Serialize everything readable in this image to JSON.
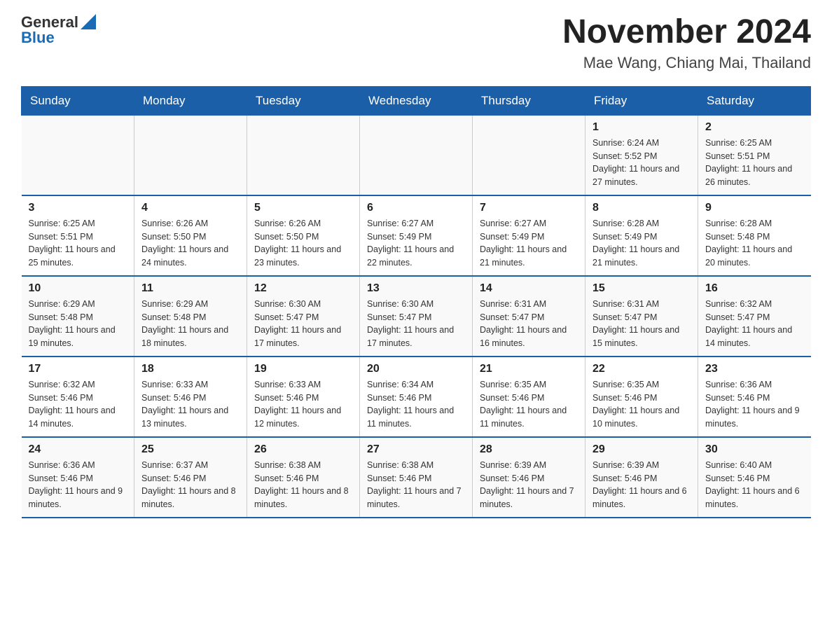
{
  "header": {
    "logo": {
      "general": "General",
      "blue": "Blue"
    },
    "title": "November 2024",
    "location": "Mae Wang, Chiang Mai, Thailand"
  },
  "weekdays": [
    "Sunday",
    "Monday",
    "Tuesday",
    "Wednesday",
    "Thursday",
    "Friday",
    "Saturday"
  ],
  "weeks": [
    [
      {
        "day": "",
        "info": ""
      },
      {
        "day": "",
        "info": ""
      },
      {
        "day": "",
        "info": ""
      },
      {
        "day": "",
        "info": ""
      },
      {
        "day": "",
        "info": ""
      },
      {
        "day": "1",
        "info": "Sunrise: 6:24 AM\nSunset: 5:52 PM\nDaylight: 11 hours and 27 minutes."
      },
      {
        "day": "2",
        "info": "Sunrise: 6:25 AM\nSunset: 5:51 PM\nDaylight: 11 hours and 26 minutes."
      }
    ],
    [
      {
        "day": "3",
        "info": "Sunrise: 6:25 AM\nSunset: 5:51 PM\nDaylight: 11 hours and 25 minutes."
      },
      {
        "day": "4",
        "info": "Sunrise: 6:26 AM\nSunset: 5:50 PM\nDaylight: 11 hours and 24 minutes."
      },
      {
        "day": "5",
        "info": "Sunrise: 6:26 AM\nSunset: 5:50 PM\nDaylight: 11 hours and 23 minutes."
      },
      {
        "day": "6",
        "info": "Sunrise: 6:27 AM\nSunset: 5:49 PM\nDaylight: 11 hours and 22 minutes."
      },
      {
        "day": "7",
        "info": "Sunrise: 6:27 AM\nSunset: 5:49 PM\nDaylight: 11 hours and 21 minutes."
      },
      {
        "day": "8",
        "info": "Sunrise: 6:28 AM\nSunset: 5:49 PM\nDaylight: 11 hours and 21 minutes."
      },
      {
        "day": "9",
        "info": "Sunrise: 6:28 AM\nSunset: 5:48 PM\nDaylight: 11 hours and 20 minutes."
      }
    ],
    [
      {
        "day": "10",
        "info": "Sunrise: 6:29 AM\nSunset: 5:48 PM\nDaylight: 11 hours and 19 minutes."
      },
      {
        "day": "11",
        "info": "Sunrise: 6:29 AM\nSunset: 5:48 PM\nDaylight: 11 hours and 18 minutes."
      },
      {
        "day": "12",
        "info": "Sunrise: 6:30 AM\nSunset: 5:47 PM\nDaylight: 11 hours and 17 minutes."
      },
      {
        "day": "13",
        "info": "Sunrise: 6:30 AM\nSunset: 5:47 PM\nDaylight: 11 hours and 17 minutes."
      },
      {
        "day": "14",
        "info": "Sunrise: 6:31 AM\nSunset: 5:47 PM\nDaylight: 11 hours and 16 minutes."
      },
      {
        "day": "15",
        "info": "Sunrise: 6:31 AM\nSunset: 5:47 PM\nDaylight: 11 hours and 15 minutes."
      },
      {
        "day": "16",
        "info": "Sunrise: 6:32 AM\nSunset: 5:47 PM\nDaylight: 11 hours and 14 minutes."
      }
    ],
    [
      {
        "day": "17",
        "info": "Sunrise: 6:32 AM\nSunset: 5:46 PM\nDaylight: 11 hours and 14 minutes."
      },
      {
        "day": "18",
        "info": "Sunrise: 6:33 AM\nSunset: 5:46 PM\nDaylight: 11 hours and 13 minutes."
      },
      {
        "day": "19",
        "info": "Sunrise: 6:33 AM\nSunset: 5:46 PM\nDaylight: 11 hours and 12 minutes."
      },
      {
        "day": "20",
        "info": "Sunrise: 6:34 AM\nSunset: 5:46 PM\nDaylight: 11 hours and 11 minutes."
      },
      {
        "day": "21",
        "info": "Sunrise: 6:35 AM\nSunset: 5:46 PM\nDaylight: 11 hours and 11 minutes."
      },
      {
        "day": "22",
        "info": "Sunrise: 6:35 AM\nSunset: 5:46 PM\nDaylight: 11 hours and 10 minutes."
      },
      {
        "day": "23",
        "info": "Sunrise: 6:36 AM\nSunset: 5:46 PM\nDaylight: 11 hours and 9 minutes."
      }
    ],
    [
      {
        "day": "24",
        "info": "Sunrise: 6:36 AM\nSunset: 5:46 PM\nDaylight: 11 hours and 9 minutes."
      },
      {
        "day": "25",
        "info": "Sunrise: 6:37 AM\nSunset: 5:46 PM\nDaylight: 11 hours and 8 minutes."
      },
      {
        "day": "26",
        "info": "Sunrise: 6:38 AM\nSunset: 5:46 PM\nDaylight: 11 hours and 8 minutes."
      },
      {
        "day": "27",
        "info": "Sunrise: 6:38 AM\nSunset: 5:46 PM\nDaylight: 11 hours and 7 minutes."
      },
      {
        "day": "28",
        "info": "Sunrise: 6:39 AM\nSunset: 5:46 PM\nDaylight: 11 hours and 7 minutes."
      },
      {
        "day": "29",
        "info": "Sunrise: 6:39 AM\nSunset: 5:46 PM\nDaylight: 11 hours and 6 minutes."
      },
      {
        "day": "30",
        "info": "Sunrise: 6:40 AM\nSunset: 5:46 PM\nDaylight: 11 hours and 6 minutes."
      }
    ]
  ]
}
